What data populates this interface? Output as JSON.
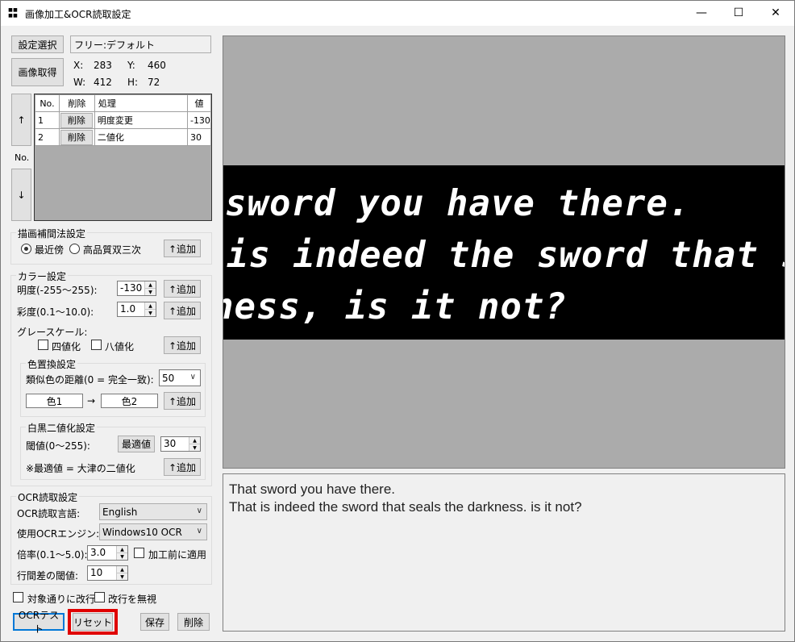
{
  "window": {
    "title": "画像加工&OCR読取設定",
    "minimize": "—",
    "maximize": "☐",
    "close": "✕"
  },
  "top": {
    "settings_select_label": "設定選択",
    "preset_value": "フリー:デフォルト",
    "capture_label": "画像取得",
    "x_label": "X:",
    "x_value": "283",
    "y_label": "Y:",
    "y_value": "460",
    "w_label": "W:",
    "w_value": "412",
    "h_label": "H:",
    "h_value": "72"
  },
  "order": {
    "up": "↑",
    "no": "No.",
    "down": "↓"
  },
  "steps": {
    "headers": [
      "No.",
      "削除",
      "処理",
      "値"
    ],
    "rows": [
      {
        "no": "1",
        "del": "削除",
        "proc": "明度変更",
        "val": "-130"
      },
      {
        "no": "2",
        "del": "削除",
        "proc": "二値化",
        "val": "30"
      }
    ]
  },
  "interp": {
    "title": "描画補間法設定",
    "opt1": "最近傍",
    "opt2": "高品質双三次",
    "add": "↑追加"
  },
  "color": {
    "title": "カラー設定",
    "brightness_label": "明度(-255〜255):",
    "brightness_value": "-130",
    "saturation_label": "彩度(0.1〜10.0):",
    "saturation_value": "1.0",
    "grayscale_label": "グレースケール:",
    "four_label": "四値化",
    "eight_label": "八値化",
    "add": "↑追加"
  },
  "replace": {
    "title": "色置換設定",
    "distance_label": "類似色の距離(0 = 完全一致):",
    "distance_value": "50",
    "color1": "色1",
    "arrow": "→",
    "color2": "色2",
    "add": "↑追加"
  },
  "binarize": {
    "title": "白黒二値化設定",
    "threshold_label": "閾値(0〜255):",
    "optimal": "最適値",
    "threshold_value": "30",
    "note": "※最適値 = 大津の二値化",
    "add": "↑追加"
  },
  "ocr": {
    "title": "OCR読取設定",
    "lang_label": "OCR読取言語:",
    "lang_value": "English",
    "engine_label": "使用OCRエンジン:",
    "engine_value": "Windows10 OCR",
    "scale_label": "倍率(0.1〜5.0):",
    "scale_value": "3.0",
    "pre_apply": "加工前に適用",
    "linegap_label": "行間差の閾値:",
    "linegap_value": "10"
  },
  "options": {
    "break_by_target": "対象通りに改行",
    "ignore_break": "改行を無視"
  },
  "bottom": {
    "ocr_test": "OCRテスト",
    "reset": "リセット",
    "save": "保存",
    "delete": "削除"
  },
  "preview": {
    "line1": "sword you have there.",
    "line2": "is indeed the sword that seal",
    "line3": "ness, is it not?"
  },
  "result": {
    "line1": "That sword you have there.",
    "line2": "That is indeed the sword that seals the darkness. is it not?"
  },
  "colors": {
    "highlight": "#e00000",
    "accent": "#0078d7"
  }
}
